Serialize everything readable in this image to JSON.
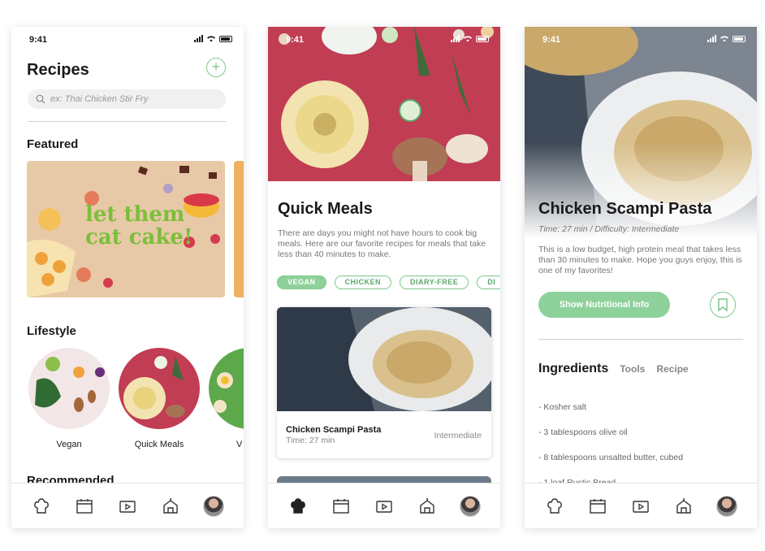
{
  "screens": {
    "recipes": {
      "status_time": "9:41",
      "title": "Recipes",
      "add_icon": "plus-circle-icon",
      "search_placeholder": "ex: Thai Chicken Stir Fry",
      "featured_heading": "Featured",
      "featured_card_text_line1": "let them",
      "featured_card_text_line2": "cat cake!",
      "lifestyle_heading": "Lifestyle",
      "lifestyle_items": [
        "Vegan",
        "Quick Meals",
        "V"
      ],
      "recommended_heading": "Recommended"
    },
    "quick_meals": {
      "status_time": "9:41",
      "title": "Quick Meals",
      "description": "There are days you might not have hours to cook big meals. Here are our favorite recipes for meals that take less than 40 minutes to make.",
      "chips": [
        "VEGAN",
        "CHICKEN",
        "DIARY-FREE",
        "DI"
      ],
      "active_chip": "VEGAN",
      "card": {
        "title": "Chicken Scampi Pasta",
        "time": "Time: 27 min",
        "difficulty": "Intermediate"
      }
    },
    "recipe_detail": {
      "status_time": "9:41",
      "title": "Chicken Scampi Pasta",
      "meta": "Time: 27 min / Difficulty: Intermediate",
      "description": "This is a low budget, high protein meal that takes less than 30 minutes to make. Hope you guys enjoy, this is one of my favorites!",
      "nutrition_button": "Show Nutritional Info",
      "tabs": [
        "Ingredients",
        "Tools",
        "Recipe"
      ],
      "ingredients": [
        "- Kosher salt",
        "- 3 tablespoons olive oil",
        "- 8 tablespoons unsalted butter, cubed",
        "- 1 loaf Rustic Bread"
      ]
    }
  },
  "tabbar_icons": [
    "chef-hat-icon",
    "calendar-icon",
    "video-icon",
    "market-icon",
    "avatar"
  ],
  "colors": {
    "accent_green": "#7dc98a",
    "hero_red": "#c13d53"
  }
}
